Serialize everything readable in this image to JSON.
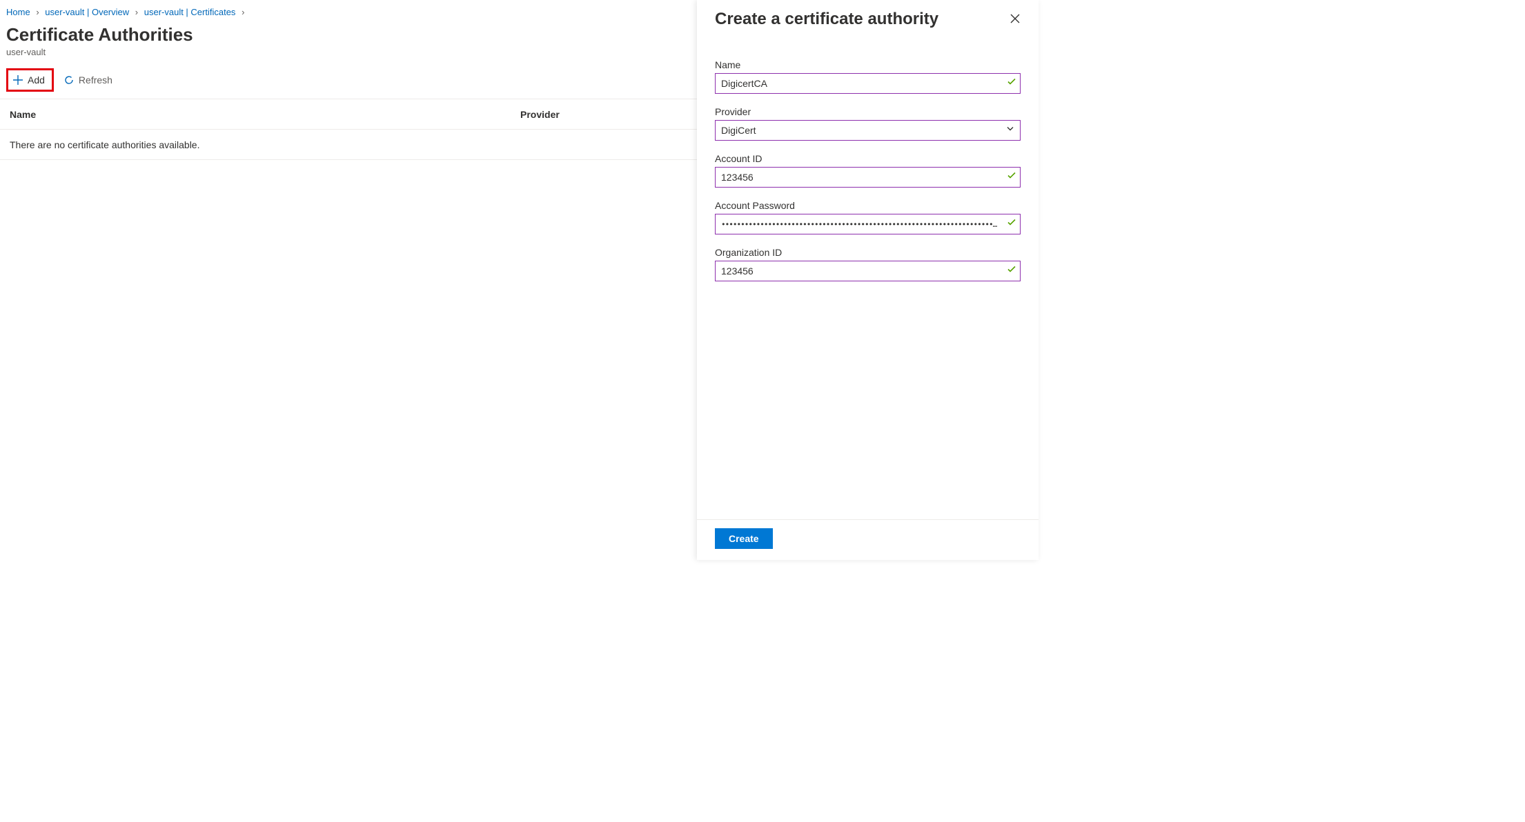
{
  "breadcrumb": {
    "items": [
      {
        "label": "Home"
      },
      {
        "label": "user-vault | Overview"
      },
      {
        "label": "user-vault | Certificates"
      }
    ]
  },
  "page": {
    "title": "Certificate Authorities",
    "subtitle": "user-vault"
  },
  "toolbar": {
    "add_label": "Add",
    "refresh_label": "Refresh"
  },
  "table": {
    "col_name": "Name",
    "col_provider": "Provider",
    "empty": "There are no certificate authorities available."
  },
  "panel": {
    "title": "Create a certificate authority",
    "fields": {
      "name": {
        "label": "Name",
        "value": "DigicertCA"
      },
      "provider": {
        "label": "Provider",
        "value": "DigiCert"
      },
      "accountId": {
        "label": "Account ID",
        "value": "123456"
      },
      "password": {
        "label": "Account Password",
        "value": "••••••••••••••••••••••••••••••••••••••••••••••••••••••••••••••••••••••••••••••••••••••••••••••••••••••••••"
      },
      "orgId": {
        "label": "Organization ID",
        "value": "123456"
      }
    },
    "create_label": "Create"
  }
}
